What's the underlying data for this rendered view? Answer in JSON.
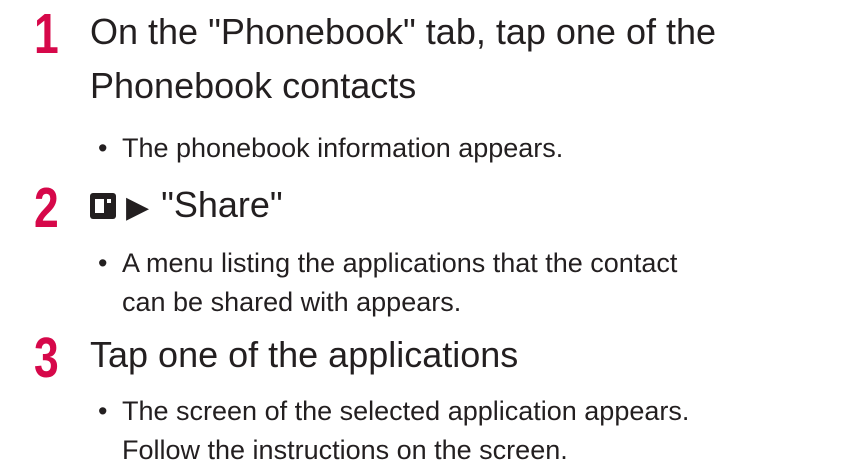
{
  "steps": [
    {
      "number": "1",
      "title_lines": [
        "On the \"Phonebook\" tab, tap one of the",
        "Phonebook contacts"
      ],
      "bullet": {
        "marker": "•",
        "lines": [
          "The phonebook information appears."
        ]
      }
    },
    {
      "number": "2",
      "menu_icon": "menu-key-icon",
      "arrow_glyph": "▶",
      "title": "\"Share\"",
      "bullet": {
        "marker": "•",
        "lines": [
          "A menu listing the applications that the contact",
          "can be shared with appears."
        ]
      }
    },
    {
      "number": "3",
      "title": "Tap one of the applications",
      "bullet": {
        "marker": "•",
        "lines": [
          "The screen of the selected application appears.",
          "Follow the instructions on the screen."
        ]
      }
    }
  ],
  "colors": {
    "step_number": "#d6084a",
    "text": "#231f20"
  }
}
